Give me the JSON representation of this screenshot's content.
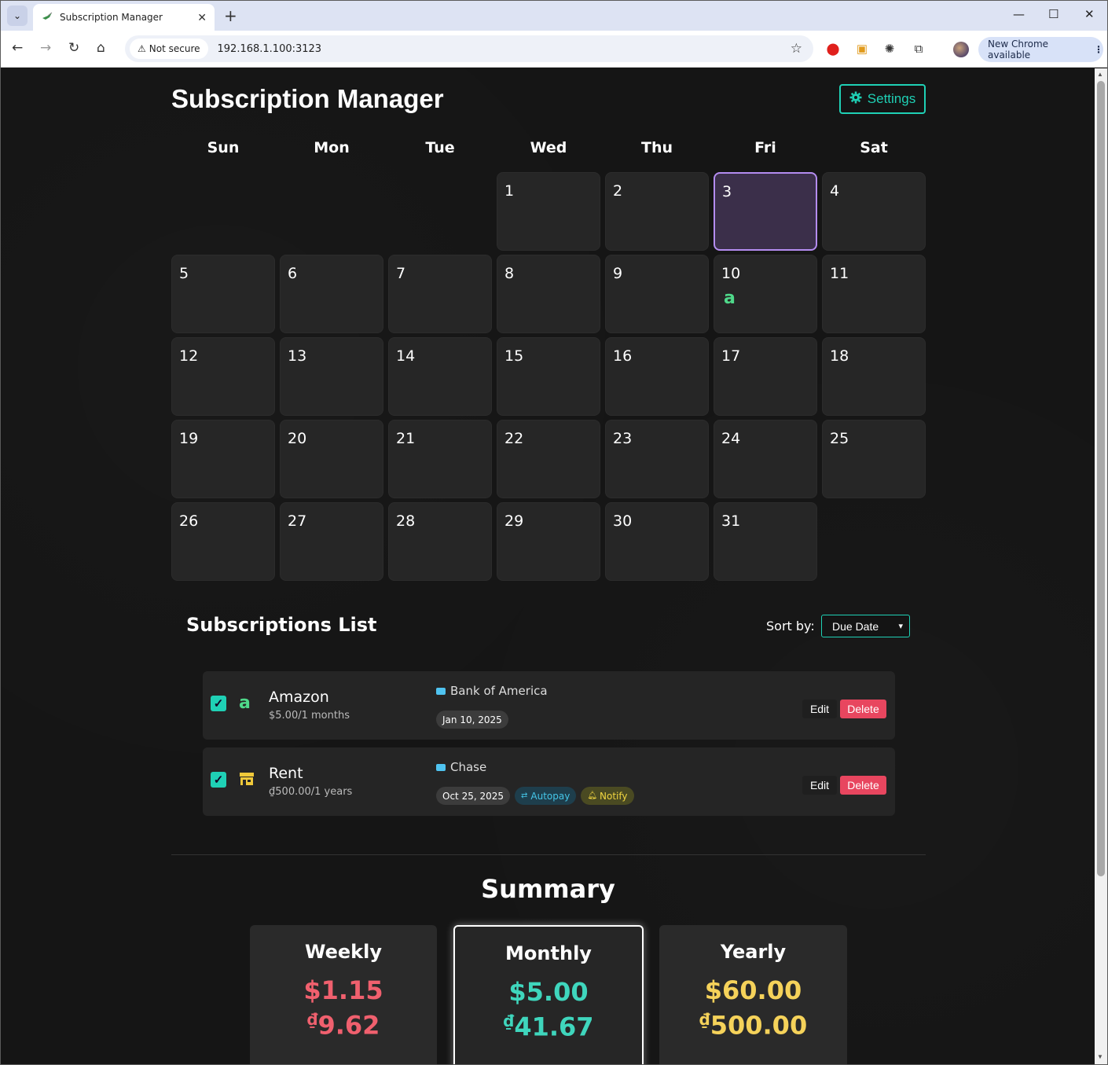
{
  "browser": {
    "tab_title": "Subscription Manager",
    "not_secure_label": "Not secure",
    "url": "192.168.1.100:3123",
    "update_label": "New Chrome available"
  },
  "app": {
    "title": "Subscription Manager",
    "settings_label": "Settings"
  },
  "calendar": {
    "weekdays": [
      "Sun",
      "Mon",
      "Tue",
      "Wed",
      "Thu",
      "Fri",
      "Sat"
    ],
    "first_weekday_index": 3,
    "days_in_month": 31,
    "today": 3,
    "subscription_days": [
      10
    ],
    "subscription_icon": "a"
  },
  "list": {
    "title": "Subscriptions List",
    "sort_label": "Sort by:",
    "sort_value": "Due Date",
    "edit_label": "Edit",
    "delete_label": "Delete",
    "items": [
      {
        "name": "Amazon",
        "price": "$5.00/1 months",
        "bank": "Bank of America",
        "due_date": "Jan 10, 2025",
        "icon": "amazon-icon",
        "autopay": "",
        "notify": ""
      },
      {
        "name": "Rent",
        "price": "₫500.00/1 years",
        "bank": "Chase",
        "due_date": "Oct 25, 2025",
        "icon": "store-icon",
        "autopay": "Autopay",
        "notify": "Notify"
      }
    ]
  },
  "summary": {
    "title": "Summary",
    "weekly": {
      "label": "Weekly",
      "usd": "$1.15",
      "vnd": "9.62",
      "color": "#f0606e"
    },
    "monthly": {
      "label": "Monthly",
      "usd": "$5.00",
      "vnd": "41.67",
      "color": "#3fd6bd"
    },
    "yearly": {
      "label": "Yearly",
      "usd": "$60.00",
      "vnd": "500.00",
      "color": "#f5d25a"
    },
    "currency_symbol": "₫"
  }
}
